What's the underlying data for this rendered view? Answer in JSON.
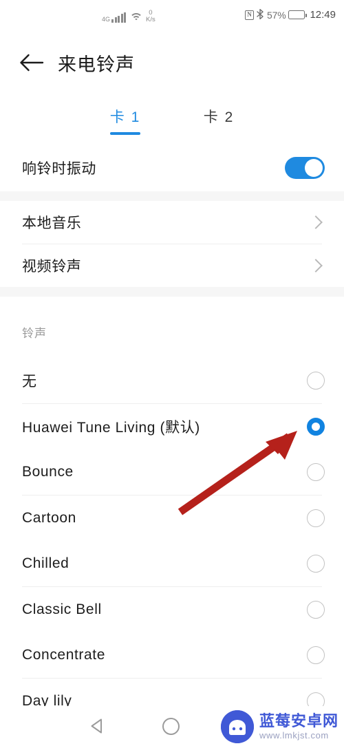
{
  "status_bar": {
    "network_type": "4G",
    "signal_icon": "signal-bars-icon",
    "wifi_icon": "wifi-icon",
    "data_speed_value": "0",
    "data_speed_unit": "K/s",
    "nfc_icon": "nfc-icon",
    "nfc_glyph": "N",
    "bluetooth_icon": "bluetooth-icon",
    "bluetooth_glyph": "�ద",
    "battery_percent": "57%",
    "battery_icon": "battery-icon",
    "time": "12:49"
  },
  "header": {
    "back_icon": "back-arrow-icon",
    "title": "来电铃声"
  },
  "tabs": [
    {
      "label": "卡 1",
      "active": true
    },
    {
      "label": "卡 2",
      "active": false
    }
  ],
  "vibrate_row": {
    "label": "响铃时振动",
    "toggle_on": true,
    "toggle_color": "#1f8ae0"
  },
  "link_rows": [
    {
      "label": "本地音乐",
      "chevron_icon": "chevron-right-icon"
    },
    {
      "label": "视频铃声",
      "chevron_icon": "chevron-right-icon"
    }
  ],
  "ringtone_section": {
    "header": "铃声",
    "items": [
      {
        "label": "无",
        "selected": false
      },
      {
        "label": "Huawei Tune Living (默认)",
        "selected": true
      },
      {
        "label": "Bounce",
        "selected": false
      },
      {
        "label": "Cartoon",
        "selected": false
      },
      {
        "label": "Chilled",
        "selected": false
      },
      {
        "label": "Classic Bell",
        "selected": false
      },
      {
        "label": "Concentrate",
        "selected": false
      },
      {
        "label": "Day lily",
        "selected": false
      }
    ],
    "selected_color": "#1183e0"
  },
  "annotation": {
    "arrow_icon": "red-arrow-annotation",
    "color": "#b5211b"
  },
  "nav_bar": {
    "back_icon": "nav-back-triangle-icon",
    "home_icon": "nav-home-circle-icon"
  },
  "watermark": {
    "logo_icon": "android-robot-logo-icon",
    "site_name": "蓝莓安卓网",
    "site_url": "www.lmkjst.com",
    "brand_color": "#4059d6"
  }
}
